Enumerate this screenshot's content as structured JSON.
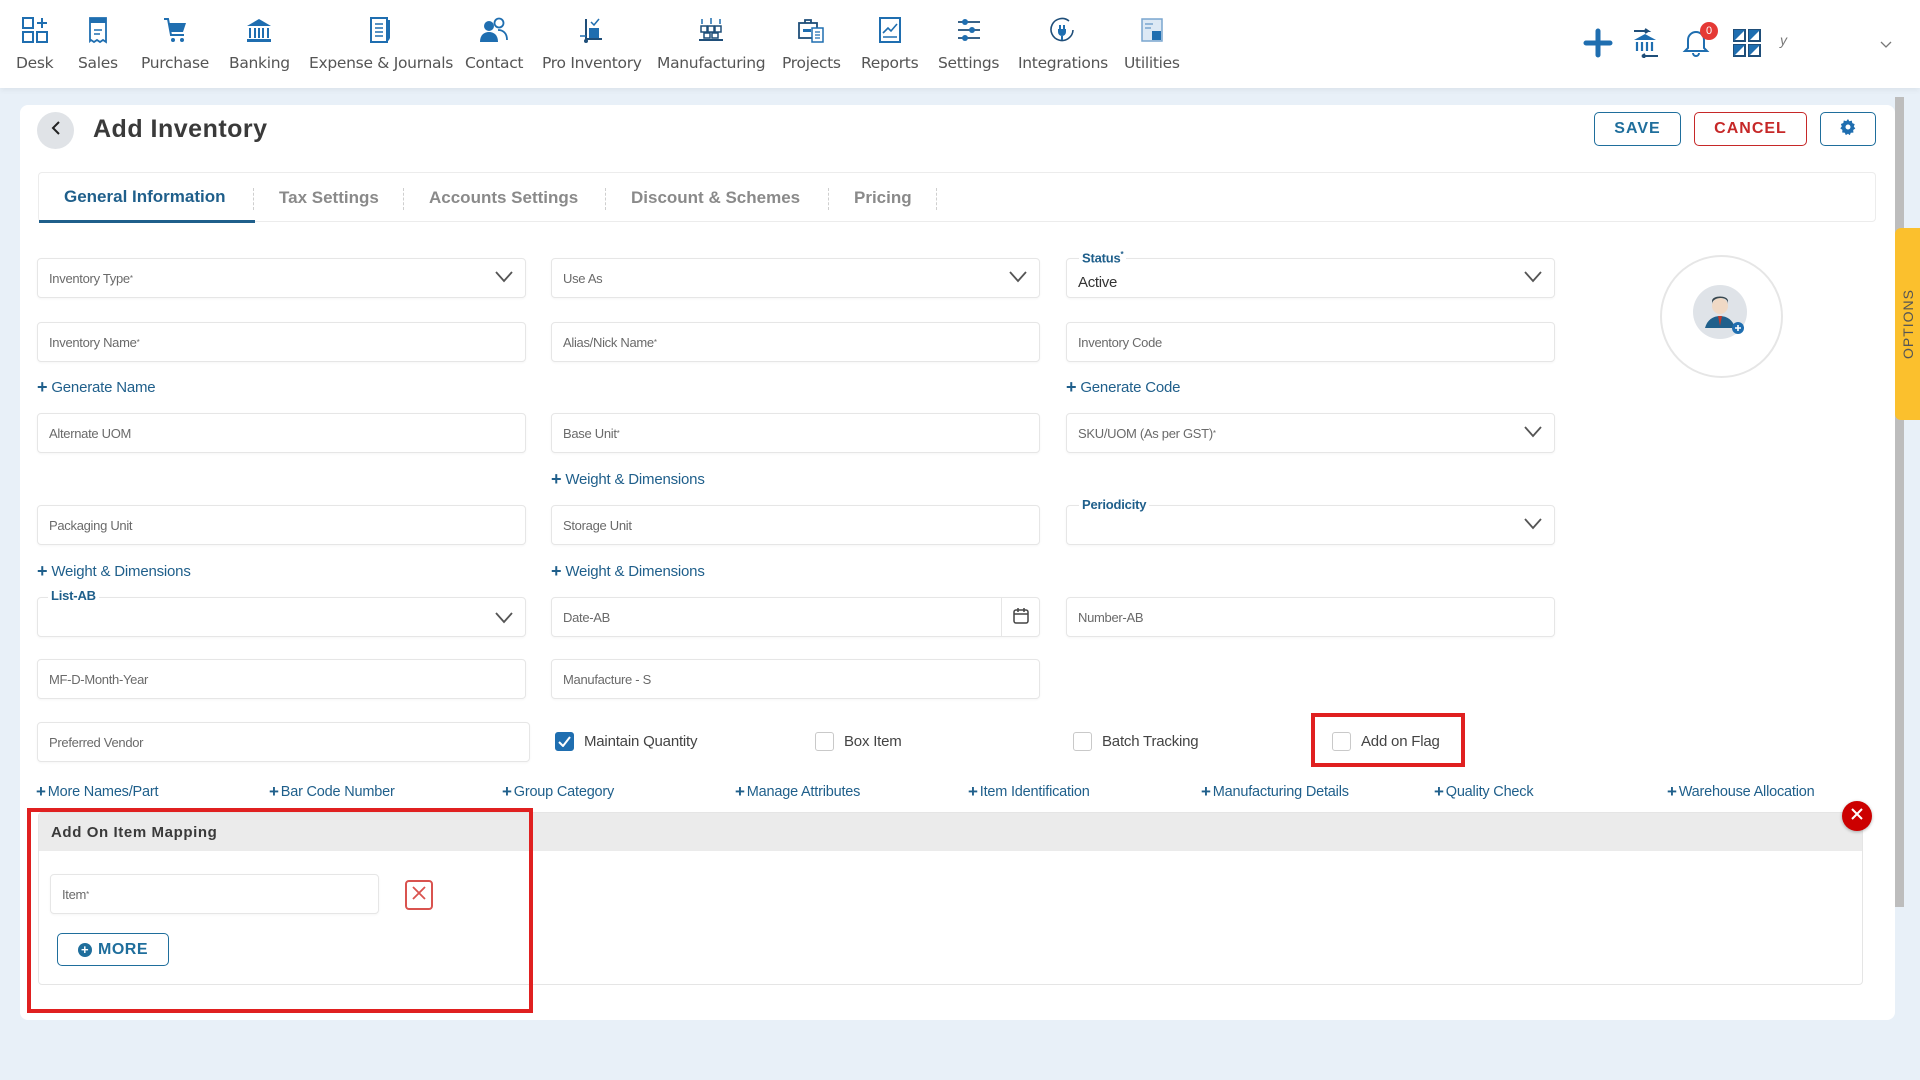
{
  "nav": {
    "items": [
      {
        "label": "Desk",
        "icon": "desk-grid-icon"
      },
      {
        "label": "Sales",
        "icon": "receipt-icon"
      },
      {
        "label": "Purchase",
        "icon": "cart-icon"
      },
      {
        "label": "Banking",
        "icon": "bank-icon"
      },
      {
        "label": "Expense & Journals",
        "icon": "notebook-icon"
      },
      {
        "label": "Contact",
        "icon": "contacts-icon"
      },
      {
        "label": "Pro Inventory",
        "icon": "hand-truck-icon"
      },
      {
        "label": "Manufacturing",
        "icon": "factory-boxes-icon"
      },
      {
        "label": "Projects",
        "icon": "briefcase-icon"
      },
      {
        "label": "Reports",
        "icon": "report-chart-icon"
      },
      {
        "label": "Settings",
        "icon": "sliders-icon"
      },
      {
        "label": "Integrations",
        "icon": "plug-icon"
      },
      {
        "label": "Utilities",
        "icon": "utilities-icon"
      }
    ],
    "notification_count": "0",
    "user_initial": "y"
  },
  "header": {
    "title": "Add Inventory",
    "save_label": "SAVE",
    "cancel_label": "CANCEL"
  },
  "tabs": [
    {
      "label": "General Information",
      "active": true
    },
    {
      "label": "Tax Settings"
    },
    {
      "label": "Accounts Settings"
    },
    {
      "label": "Discount & Schemes"
    },
    {
      "label": "Pricing"
    }
  ],
  "side_tab": "OPTIONS",
  "form": {
    "inventory_type": "Inventory Type",
    "use_as": "Use As",
    "status_label": "Status",
    "status_value": "Active",
    "inventory_name": "Inventory Name",
    "alias_name": "Alias/Nick Name",
    "inventory_code": "Inventory Code",
    "generate_name": "Generate Name",
    "generate_code": "Generate Code",
    "alternate_uom": "Alternate UOM",
    "base_unit": "Base Unit",
    "sku_uom": "SKU/UOM (As per GST)",
    "weight_dimensions": "Weight & Dimensions",
    "packaging_unit": "Packaging Unit",
    "storage_unit": "Storage Unit",
    "periodicity_label": "Periodicity",
    "list_ab_label": "List-AB",
    "date_ab": "Date-AB",
    "number_ab": "Number-AB",
    "mf_d_month_year": "MF-D-Month-Year",
    "manufacture_s": "Manufacture - S",
    "preferred_vendor": "Preferred Vendor",
    "required_mark": "*"
  },
  "checkboxes": [
    {
      "label": "Maintain Quantity",
      "checked": true
    },
    {
      "label": "Box Item",
      "checked": false
    },
    {
      "label": "Batch Tracking",
      "checked": false
    },
    {
      "label": "Add on Flag",
      "checked": false
    }
  ],
  "links": [
    "More Names/Part",
    "Bar Code Number",
    "Group Category",
    "Manage Attributes",
    "Item Identification",
    "Manufacturing Details",
    "Quality Check",
    "Warehouse Allocation"
  ],
  "mapping": {
    "title": "Add On Item Mapping",
    "item_placeholder": "Item",
    "more_label": "MORE"
  },
  "colors": {
    "primary": "#1f5f8b",
    "danger": "#c62828",
    "highlight": "#e02020",
    "options_tab": "#fbc02d"
  }
}
